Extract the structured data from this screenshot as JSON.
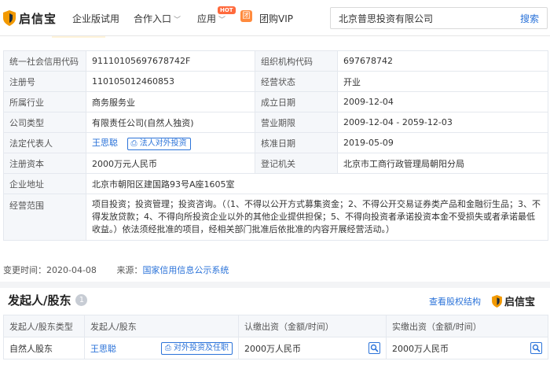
{
  "nav": {
    "brand": "启信宝",
    "items": [
      {
        "label": "企业版试用"
      },
      {
        "label": "合作入口",
        "has_dropdown": true
      },
      {
        "label": "应用",
        "has_dropdown": true,
        "badge": "HOT"
      },
      {
        "label": "团购VIP",
        "icon": "group-buy-icon"
      }
    ],
    "search": {
      "value": "北京普思投资有限公司",
      "button": "搜索"
    }
  },
  "info_table": {
    "rows": [
      {
        "l1": "统一社会信用代码",
        "v1": "91110105697678742F",
        "l2": "组织机构代码",
        "v2": "697678742"
      },
      {
        "l1": "注册号",
        "v1": "110105012460853",
        "l2": "经营状态",
        "v2": "开业"
      },
      {
        "l1": "所属行业",
        "v1": "商务服务业",
        "l2": "成立日期",
        "v2": "2009-12-04"
      },
      {
        "l1": "公司类型",
        "v1": "有限责任公司(自然人独资)",
        "l2": "营业期限",
        "v2": "2009-12-04 - 2059-12-03"
      },
      {
        "l1": "法定代表人",
        "v1": "王思聪",
        "v1_button": "法人对外投资",
        "l2": "核准日期",
        "v2": "2019-05-09"
      },
      {
        "l1": "注册资本",
        "v1": "2000万元人民币",
        "l2": "登记机关",
        "v2": "北京市工商行政管理局朝阳分局"
      }
    ],
    "address_label": "企业地址",
    "address": "北京市朝阳区建国路93号A座1605室",
    "scope_label": "经营范围",
    "scope": "项目投资；投资管理；投资咨询。（（1、不得以公开方式募集资金；2、不得公开交易证券类产品和金融衍生品；3、不得发放贷款；4、不得向所投资企业以外的其他企业提供担保；5、不得向投资者承诺投资本金不受损失或者承诺最低收益。）依法须经批准的项目，经相关部门批准后依批准的内容开展经营活动。）"
  },
  "meta": {
    "changed_label": "变更时间：",
    "changed": "2020-04-08",
    "source_label": "来源：",
    "source": "国家信用信息公示系统"
  },
  "shareholders": {
    "title": "发起人/股东",
    "count": "1",
    "link": "查看股权结构",
    "brand": "启信宝",
    "headers": [
      "发起人/股东类型",
      "发起人/股东",
      "认缴出资（金额/时间）",
      "实缴出资（金额/时间）"
    ],
    "rows": [
      {
        "type": "自然人股东",
        "name": "王思聪",
        "button": "对外投资及任职",
        "subscribed": "2000万人民币",
        "paid": "2000万人民币"
      }
    ]
  },
  "colors": {
    "brand_orange": "#f29900",
    "link_blue": "#2b73d9",
    "hot_badge": "#ff6a3d"
  }
}
